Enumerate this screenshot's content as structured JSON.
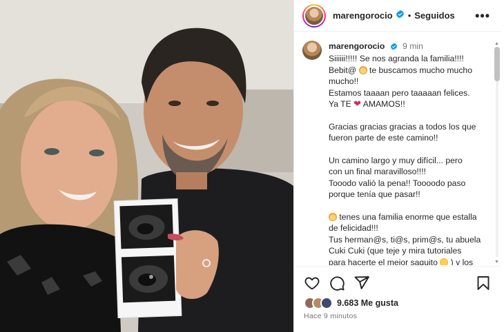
{
  "post": {
    "username": "marengorocio",
    "separator": "•",
    "follow_status": "Seguidos",
    "more_label": "•••"
  },
  "caption": {
    "username": "marengorocio",
    "time": "9 min",
    "lines": [
      "Siiiiii!!!!! Se nos agranda la familia!!!!",
      "te buscamos mucho mucho",
      "mucho!!",
      "Estamos taaaan pero taaaaan felices.",
      "AMAMOS!!",
      "Gracias gracias gracias a todos los que",
      "fueron parte de este camino!!",
      "Un camino largo y muy difícil... pero",
      "con un final maravilloso!!!!",
      "Tooodo valió la pena!! Toooodo paso",
      "porque tenía que pasar!!",
      "tenes una familia enorme que estalla",
      "de felicidad!!!",
      "Tus herman@s, ti@s, prim@s, tu abuela",
      "Cuki Cuki (que teje y mira tutoriales",
      "para hacerte el mejor saquito",
      ") y los"
    ],
    "line2_prefix": "Bebit@",
    "line5_prefix": "Ya TE",
    "heart": "❤"
  },
  "engagement": {
    "likes": "9.683 Me gusta",
    "time_ago": "Hace 9 minutos"
  },
  "icons": {
    "like": "heart-icon",
    "comment": "comment-icon",
    "share": "share-icon",
    "save": "bookmark-icon",
    "verified": "verified-badge-icon",
    "more": "more-options-icon"
  },
  "colors": {
    "verified": "#0095f6",
    "heart": "#e0245e",
    "muted": "#737373",
    "text": "#262626"
  }
}
